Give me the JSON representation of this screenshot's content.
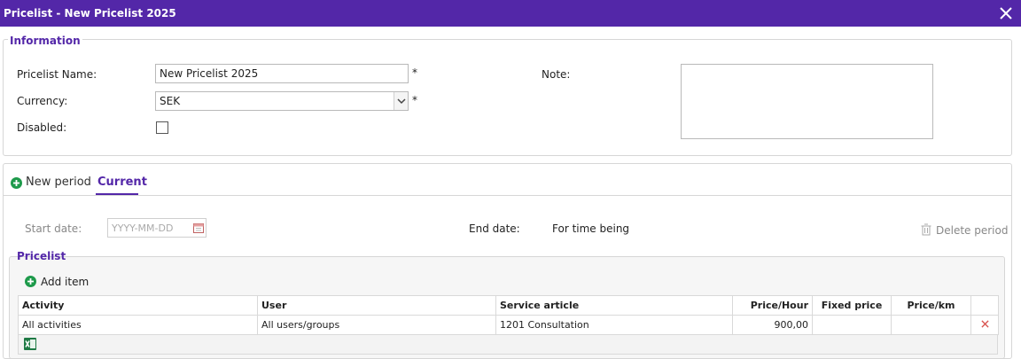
{
  "window": {
    "title": "Pricelist - New Pricelist 2025"
  },
  "information": {
    "legend": "Information",
    "name_label": "Pricelist Name:",
    "name_value": "New Pricelist 2025",
    "required_mark": "*",
    "currency_label": "Currency:",
    "currency_value": "SEK",
    "disabled_label": "Disabled:",
    "disabled_checked": false,
    "note_label": "Note:",
    "note_value": ""
  },
  "tabs": {
    "new_period": "New period",
    "current": "Current"
  },
  "period": {
    "start_label": "Start date:",
    "start_placeholder": "YYYY-MM-DD",
    "end_label": "End date:",
    "end_value": "For time being",
    "delete_label": "Delete period"
  },
  "pricelist": {
    "legend": "Pricelist",
    "add_item": "Add item",
    "columns": [
      "Activity",
      "User",
      "Service article",
      "Price/Hour",
      "Fixed price",
      "Price/km"
    ],
    "rows": [
      {
        "activity": "All activities",
        "user": "All users/groups",
        "service": "1201 Consultation",
        "price_hour": "900,00",
        "fixed": "",
        "price_km": ""
      }
    ]
  },
  "colors": {
    "accent": "#5327a8",
    "add_green": "#1e9a4b",
    "delete_red": "#d9534f"
  },
  "icons": [
    "close-icon",
    "plus-circle-icon",
    "calendar-icon",
    "trash-icon",
    "delete-x-icon",
    "excel-icon"
  ]
}
